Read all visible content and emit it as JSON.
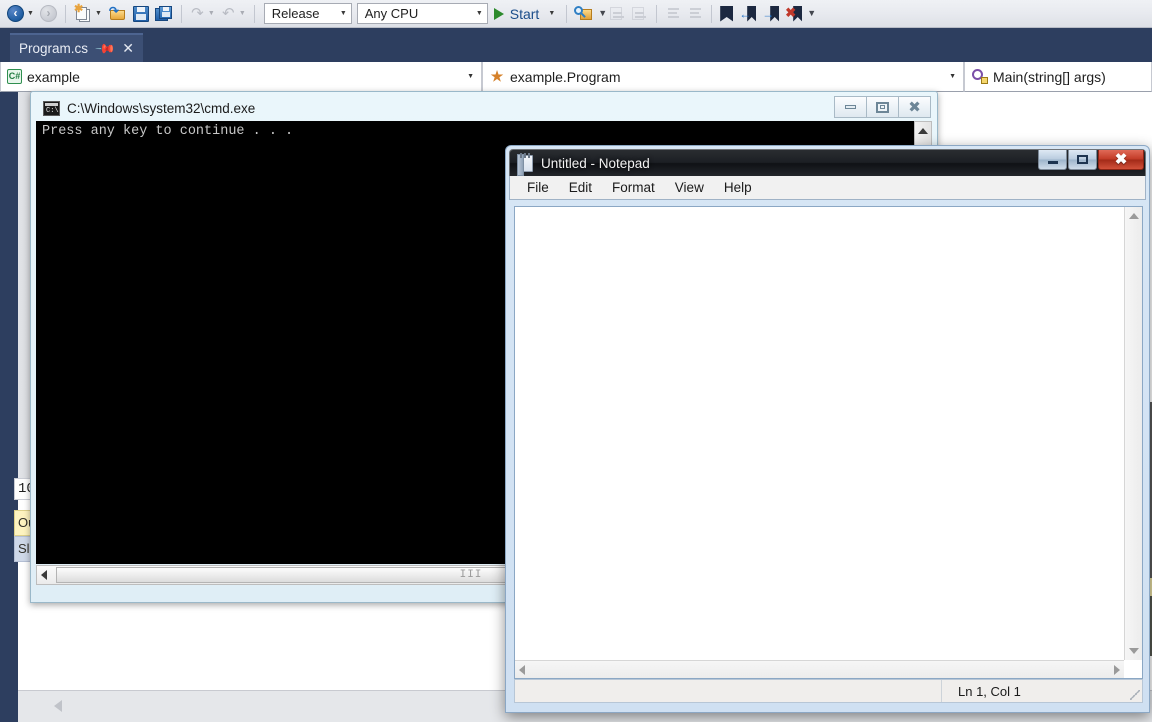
{
  "ide": {
    "toolbar": {
      "nav_back_icon": "navigate-back-icon",
      "nav_forward_icon": "navigate-forward-icon",
      "new_project_icon": "new-project-icon",
      "open_file_icon": "open-file-icon",
      "save_icon": "save-icon",
      "save_all_icon": "save-all-icon",
      "undo_icon": "undo-icon",
      "redo_icon": "redo-icon",
      "configuration": "Release",
      "platform": "Any CPU",
      "start_label": "Start",
      "find_icon": "find-in-files-icon",
      "comment_icon": "comment-selection-icon",
      "uncomment_icon": "uncomment-selection-icon",
      "decrease_indent_icon": "decrease-indent-icon",
      "increase_indent_icon": "increase-indent-icon",
      "toggle_bookmark_icon": "toggle-bookmark-icon",
      "previous_bookmark_icon": "previous-bookmark-icon",
      "next_bookmark_icon": "next-bookmark-icon",
      "clear_bookmarks_icon": "clear-bookmarks-icon",
      "overflow_icon": "toolbar-overflow-icon"
    },
    "tab": {
      "label": "Program.cs",
      "pin_icon": "pin-icon",
      "close_icon": "close-icon"
    },
    "navbar": {
      "project": "example",
      "project_icon": "csharp-project-icon",
      "class": "example.Program",
      "class_icon": "class-icon",
      "member": "Main(string[] args)",
      "member_icon": "method-icon"
    },
    "editor": {
      "line_number": "10",
      "output_tab": "Ou",
      "solution_tab": "Sl"
    }
  },
  "cmd": {
    "title": "C:\\Windows\\system32\\cmd.exe",
    "icon": "console-icon",
    "console_text": "Press any key to continue . . .",
    "minimize_label": "Minimize",
    "maximize_label": "Maximize",
    "close_label": "Close",
    "scroll_up_icon": "scroll-up-icon",
    "scroll_left_icon": "scroll-left-icon",
    "thumb_grip": "III"
  },
  "notepad": {
    "title": "Untitled - Notepad",
    "icon": "notepad-icon",
    "menus": [
      {
        "label": "File"
      },
      {
        "label": "Edit"
      },
      {
        "label": "Format"
      },
      {
        "label": "View"
      },
      {
        "label": "Help"
      }
    ],
    "document_text": "",
    "status": "Ln 1, Col 1",
    "minimize_label": "Minimize",
    "maximize_label": "Maximize",
    "close_label": "Close",
    "scroll_up_icon": "scroll-up-icon",
    "scroll_down_icon": "scroll-down-icon",
    "scroll_left_icon": "scroll-left-icon",
    "scroll_right_icon": "scroll-right-icon",
    "resize_grip_icon": "resize-grip-icon"
  },
  "colors": {
    "vs_shell": "#2d3e5f",
    "vs_tab_active": "#3c4f74",
    "start_green": "#2c8a2c",
    "notepad_close_red": "#c23b27",
    "console_bg": "#000000",
    "output_tab_yellow": "#fdf3c0"
  }
}
